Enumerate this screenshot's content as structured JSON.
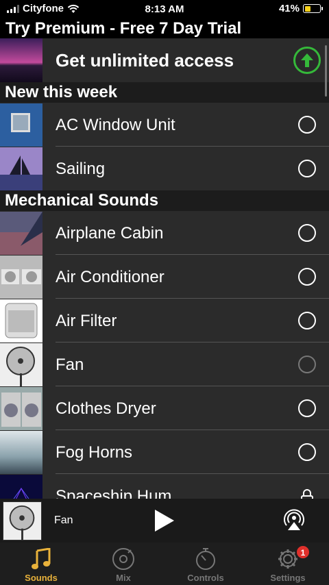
{
  "status_bar": {
    "carrier": "Cityfone",
    "time": "8:13 AM",
    "battery": "41%",
    "battery_level": 0.41
  },
  "trial_title": "Try Premium - Free 7 Day Trial",
  "premium": {
    "label": "Get unlimited access",
    "icon": "upload-arrow-icon",
    "accent": "#35b93a"
  },
  "sections": [
    {
      "title": "New this week",
      "items": [
        {
          "label": "AC Window Unit",
          "state": "radio"
        },
        {
          "label": "Sailing",
          "state": "radio"
        }
      ]
    },
    {
      "title": "Mechanical Sounds",
      "items": [
        {
          "label": "Airplane Cabin",
          "state": "radio"
        },
        {
          "label": "Air Conditioner",
          "state": "radio"
        },
        {
          "label": "Air Filter",
          "state": "radio"
        },
        {
          "label": "Fan",
          "state": "radio-playing"
        },
        {
          "label": "Clothes Dryer",
          "state": "radio"
        },
        {
          "label": "Fog Horns",
          "state": "radio"
        },
        {
          "label": "Spaceship Hum",
          "state": "locked"
        }
      ]
    }
  ],
  "player": {
    "title": "Fan"
  },
  "tabs": [
    {
      "label": "Sounds",
      "icon": "music-note-icon",
      "active": true
    },
    {
      "label": "Mix",
      "icon": "vinyl-icon",
      "active": false
    },
    {
      "label": "Controls",
      "icon": "timer-icon",
      "active": false
    },
    {
      "label": "Settings",
      "icon": "gear-icon",
      "active": false,
      "badge": "1"
    }
  ],
  "colors": {
    "active_tab": "#e9b23b",
    "badge": "#e0302b"
  }
}
